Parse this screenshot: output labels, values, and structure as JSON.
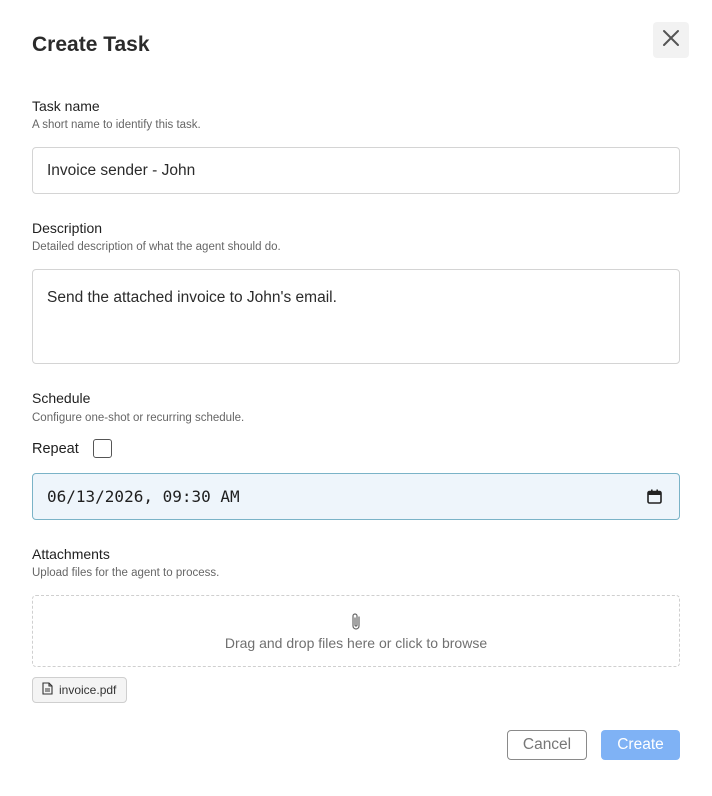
{
  "dialog": {
    "title": "Create Task",
    "close_icon": "close-icon"
  },
  "task_name": {
    "label": "Task name",
    "hint": "A short name to identify this task.",
    "value": "Invoice sender - John"
  },
  "description": {
    "label": "Description",
    "hint": "Detailed description of what the agent should do.",
    "value": "Send the attached invoice to John's email."
  },
  "schedule": {
    "label": "Schedule",
    "hint": "Configure one-shot or recurring schedule.",
    "repeat_label": "Repeat",
    "repeat_checked": false,
    "datetime_value": "06/13/2026, 09:30 AM",
    "calendar_icon": "calendar-icon"
  },
  "attachments": {
    "label": "Attachments",
    "hint": "Upload files for the agent to process.",
    "dropzone_text": "Drag and drop files here or click to browse",
    "dropzone_icon": "paperclip-icon",
    "files": [
      {
        "name": "invoice.pdf",
        "icon": "file-icon"
      }
    ]
  },
  "actions": {
    "cancel_label": "Cancel",
    "create_label": "Create",
    "create_color": "#7fb2f5"
  }
}
